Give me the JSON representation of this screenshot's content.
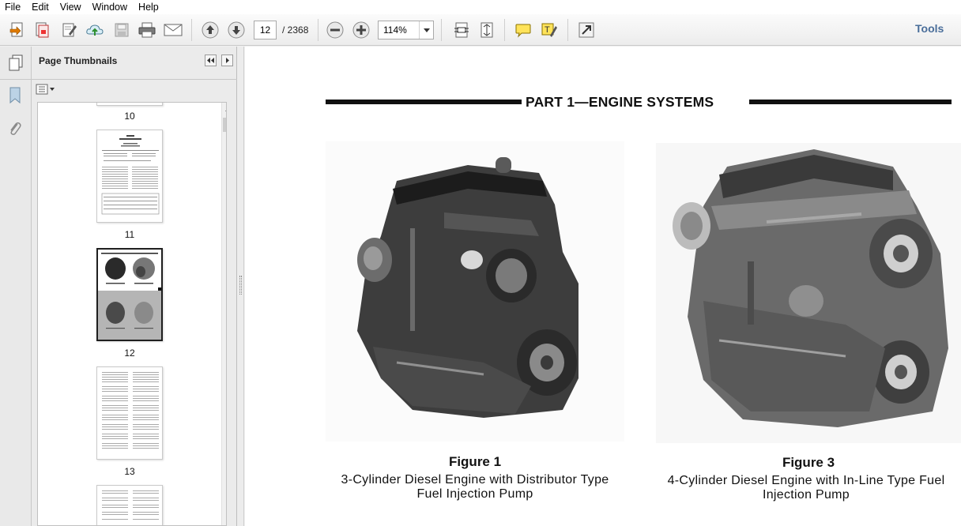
{
  "menu": [
    "File",
    "Edit",
    "View",
    "Window",
    "Help"
  ],
  "toolbar": {
    "page_current": "12",
    "page_total": "/ 2368",
    "zoom": "114%",
    "tools_label": "Tools"
  },
  "thumbnails": {
    "title": "Page Thumbnails",
    "pages": [
      "10",
      "11",
      "12",
      "13"
    ],
    "selected": "12"
  },
  "document": {
    "part_title": "PART 1—ENGINE SYSTEMS",
    "figures": [
      {
        "title": "Figure 1",
        "caption_line1": "3-Cylinder Diesel Engine with Distributor Type",
        "caption_line2": "Fuel Injection Pump"
      },
      {
        "title": "Figure 3",
        "caption_line1": "4-Cylinder Diesel Engine with In-Line Type Fuel",
        "caption_line2": "Injection Pump"
      }
    ]
  },
  "colors": {
    "tools_text": "#4a6e9a",
    "selection_border": "#1f1f1f"
  }
}
